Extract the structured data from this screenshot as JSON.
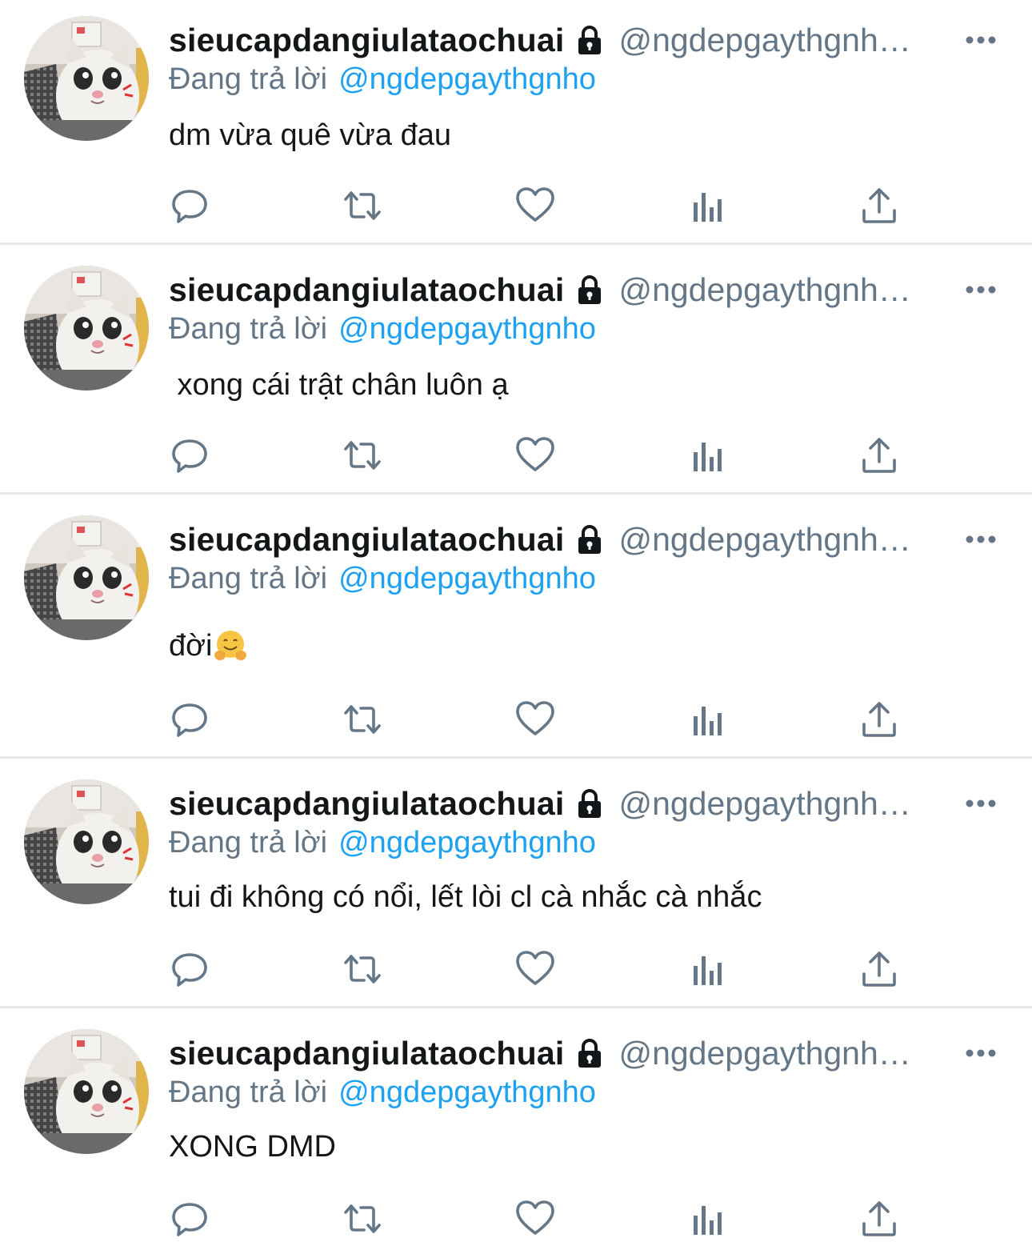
{
  "colors": {
    "text": "#14171a",
    "secondary": "#657786",
    "accent": "#1da1f2",
    "divider": "#e6e9ec"
  },
  "tweets": [
    {
      "display_name": "sieucapdangiulataochuai",
      "handle": "@ngdepgaythgnh…",
      "reply_prefix": "Đang trả lời",
      "reply_mention": "@ngdepgaythgnho",
      "text": "dm vừa quê vừa đau",
      "emoji": ""
    },
    {
      "display_name": "sieucapdangiulataochuai",
      "handle": "@ngdepgaythgnh…",
      "reply_prefix": "Đang trả lời",
      "reply_mention": "@ngdepgaythgnho",
      "text": " xong cái trật chân luôn ạ",
      "emoji": ""
    },
    {
      "display_name": "sieucapdangiulataochuai",
      "handle": "@ngdepgaythgnh…",
      "reply_prefix": "Đang trả lời",
      "reply_mention": "@ngdepgaythgnho",
      "text": "đời",
      "emoji": "hugging-face-emoji"
    },
    {
      "display_name": "sieucapdangiulataochuai",
      "handle": "@ngdepgaythgnh…",
      "reply_prefix": "Đang trả lời",
      "reply_mention": "@ngdepgaythgnho",
      "text": "tui đi không có nổi, lết lòi cl cà nhắc cà nhắc",
      "emoji": ""
    },
    {
      "display_name": "sieucapdangiulataochuai",
      "handle": "@ngdepgaythgnh…",
      "reply_prefix": "Đang trả lời",
      "reply_mention": "@ngdepgaythgnho",
      "text": "XONG DMD",
      "emoji": ""
    }
  ],
  "icons": {
    "lock": "lock-icon",
    "more": "more-options-icon",
    "reply": "reply-icon",
    "retweet": "retweet-icon",
    "like": "heart-icon",
    "analytics": "analytics-icon",
    "share": "share-icon"
  }
}
